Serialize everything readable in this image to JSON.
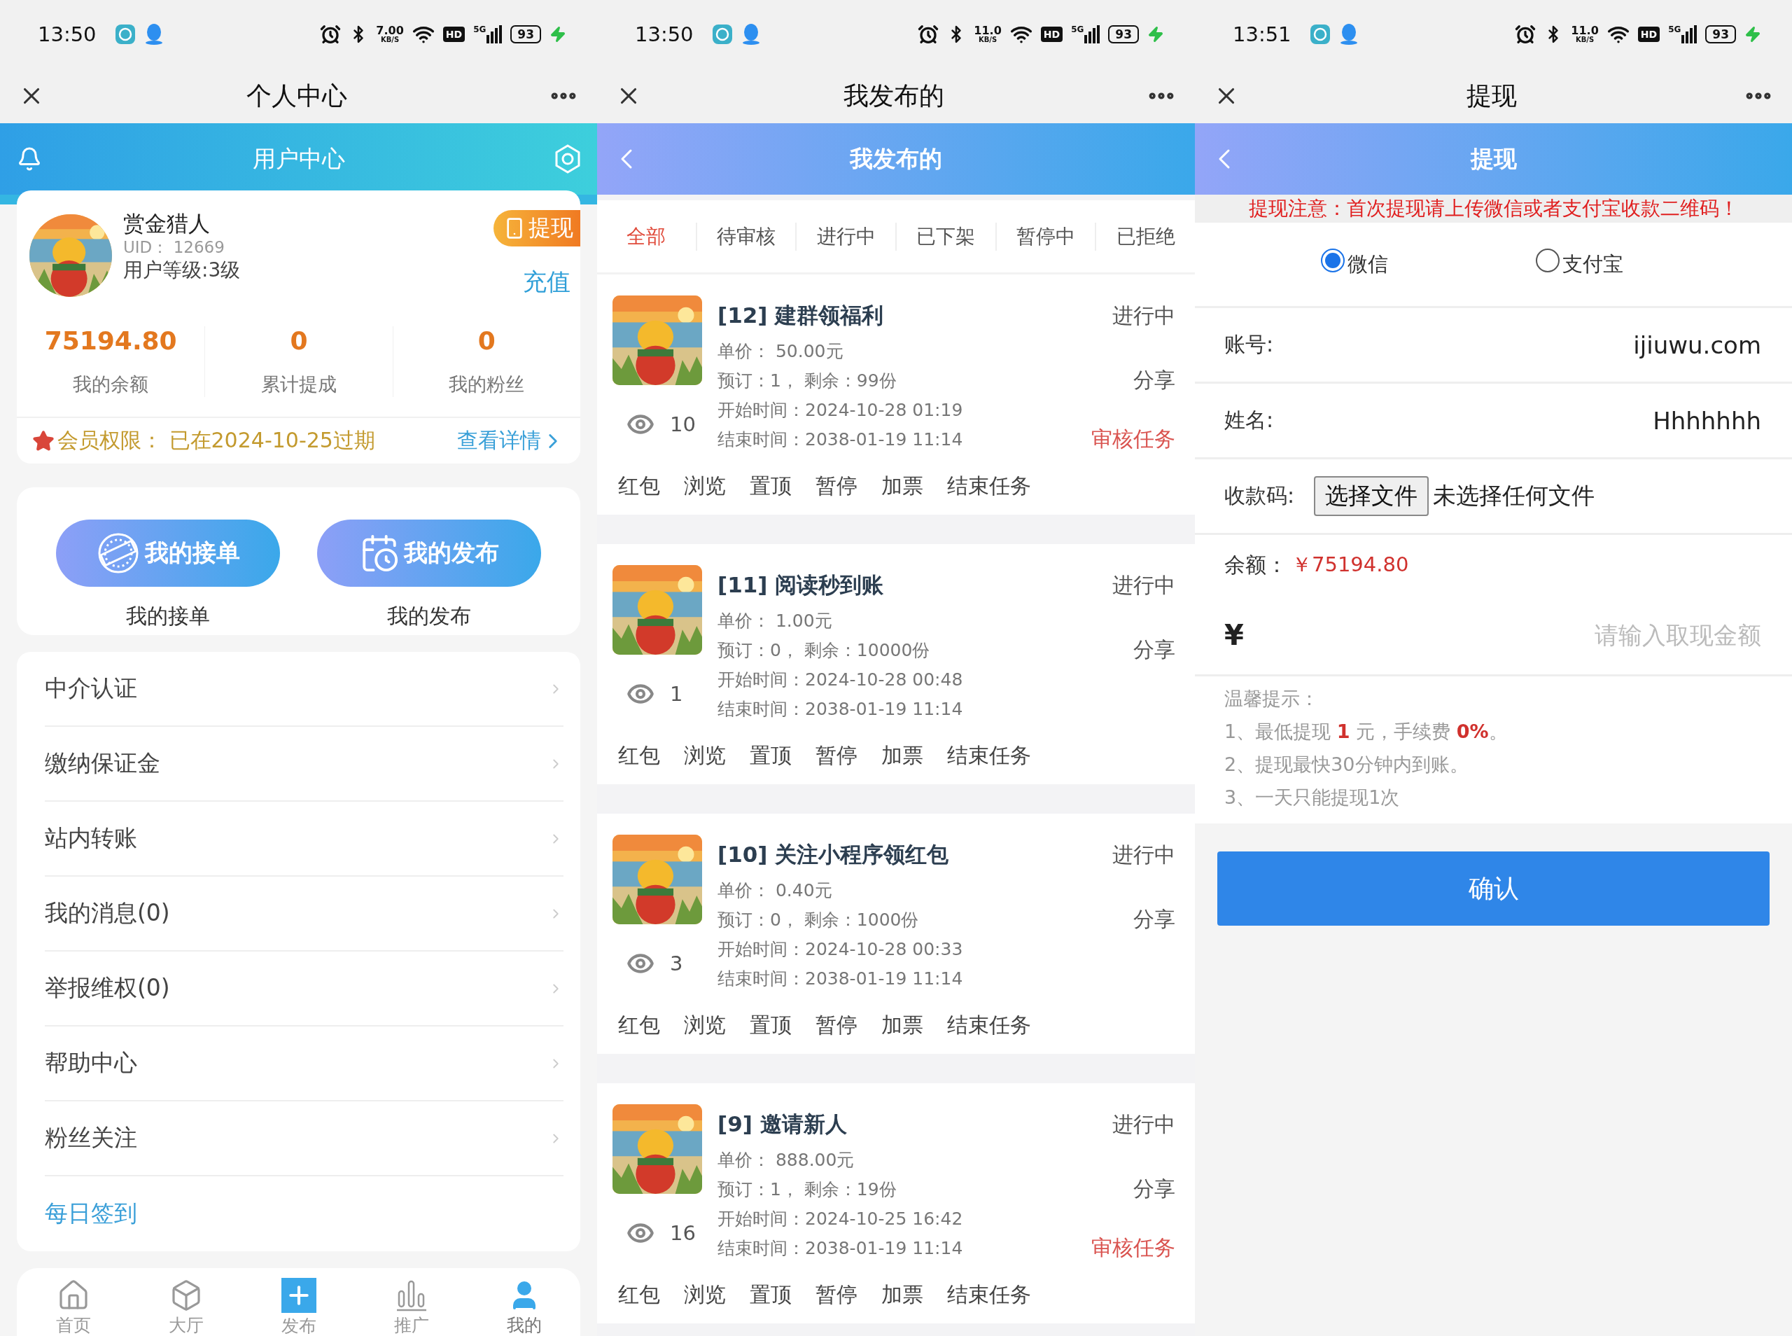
{
  "profile": {
    "status_bar": {
      "time": "13:50",
      "speed": "7.00",
      "speed_unit": "KB/S",
      "hd": "HD",
      "network": "5G",
      "battery": "93"
    },
    "top_bar": {
      "title": "个人中心"
    },
    "header": {
      "title": "用户中心"
    },
    "user": {
      "name": "赏金猎人",
      "uid": "UID：  12669",
      "level": "用户等级:3级",
      "withdraw_button": "提现",
      "recharge_link": "充值"
    },
    "stats": [
      {
        "value": "75194.80",
        "label": "我的余额"
      },
      {
        "value": "0",
        "label": "累计提成"
      },
      {
        "value": "0",
        "label": "我的粉丝"
      }
    ],
    "membership": {
      "text": "会员权限：  已在2024-10-25过期",
      "link": "查看详情"
    },
    "shortcuts": [
      {
        "button": "我的接单",
        "caption": "我的接单",
        "kind": "stamp"
      },
      {
        "button": "我的发布",
        "caption": "我的发布",
        "kind": "calendar"
      }
    ],
    "menu": [
      {
        "label": "中介认证",
        "kind": "link"
      },
      {
        "label": "缴纳保证金",
        "kind": "link"
      },
      {
        "label": "站内转账",
        "kind": "link"
      },
      {
        "label": "我的消息(0)",
        "kind": "link"
      },
      {
        "label": "举报维权(0)",
        "kind": "link"
      },
      {
        "label": "帮助中心",
        "kind": "link"
      },
      {
        "label": "粉丝关注",
        "kind": "link"
      },
      {
        "label": "每日签到",
        "kind": "accent"
      }
    ],
    "bottom_nav": [
      {
        "label": "首页",
        "kind": "home",
        "selected": false
      },
      {
        "label": "大厅",
        "kind": "box",
        "selected": false
      },
      {
        "label": "发布",
        "kind": "plus",
        "selected": false
      },
      {
        "label": "推广",
        "kind": "bars",
        "selected": false
      },
      {
        "label": "我的",
        "kind": "person",
        "selected": true
      }
    ]
  },
  "published": {
    "status_bar": {
      "time": "13:50",
      "speed": "11.0",
      "speed_unit": "KB/S",
      "hd": "HD",
      "network": "5G",
      "battery": "93"
    },
    "top_bar": {
      "title": "我发布的"
    },
    "header": {
      "title": "我发布的"
    },
    "tabs": [
      {
        "label": "全部",
        "selected": true
      },
      {
        "label": "待审核",
        "selected": false
      },
      {
        "label": "进行中",
        "selected": false
      },
      {
        "label": "已下架",
        "selected": false
      },
      {
        "label": "暂停中",
        "selected": false
      },
      {
        "label": "已拒绝",
        "selected": false
      }
    ],
    "tasks": [
      {
        "title": "[12] 建群领福利",
        "status": "进行中",
        "price": "单价：  50.00元",
        "booking": "预订：1，  剩余：99份",
        "share": "分享",
        "start": "开始时间：2024-10-28 01:19",
        "end": "结束时间：2038-01-19 11:14",
        "views": "10",
        "review": "审核任务",
        "actions": [
          "红包",
          "浏览",
          "置顶",
          "暂停",
          "加票",
          "结束任务"
        ]
      },
      {
        "title": "[11] 阅读秒到账",
        "status": "进行中",
        "price": "单价：  1.00元",
        "booking": "预订：0，  剩余：10000份",
        "share": "分享",
        "start": "开始时间：2024-10-28 00:48",
        "end": "结束时间：2038-01-19 11:14",
        "views": "1",
        "actions": [
          "红包",
          "浏览",
          "置顶",
          "暂停",
          "加票",
          "结束任务"
        ]
      },
      {
        "title": "[10] 关注小程序领红包",
        "status": "进行中",
        "price": "单价：  0.40元",
        "booking": "预订：0，  剩余：1000份",
        "share": "分享",
        "start": "开始时间：2024-10-28 00:33",
        "end": "结束时间：2038-01-19 11:14",
        "views": "3",
        "actions": [
          "红包",
          "浏览",
          "置顶",
          "暂停",
          "加票",
          "结束任务"
        ]
      },
      {
        "title": "[9] 邀请新人",
        "status": "进行中",
        "price": "单价：  888.00元",
        "booking": "预订：1，  剩余：19份",
        "share": "分享",
        "start": "开始时间：2024-10-25 16:42",
        "end": "结束时间：2038-01-19 11:14",
        "views": "16",
        "review": "审核任务",
        "actions": [
          "红包",
          "浏览",
          "置顶",
          "暂停",
          "加票",
          "结束任务"
        ]
      }
    ]
  },
  "withdraw": {
    "status_bar": {
      "time": "13:51",
      "speed": "11.0",
      "speed_unit": "KB/S",
      "hd": "HD",
      "network": "5G",
      "battery": "93"
    },
    "top_bar": {
      "title": "提现"
    },
    "header": {
      "title": "提现"
    },
    "notice": "提现注意：首次提现请上传微信或者支付宝收款二维码！",
    "methods": [
      {
        "label": "微信",
        "selected": true
      },
      {
        "label": "支付宝",
        "selected": false
      }
    ],
    "fields": [
      {
        "label": "账号:",
        "value": "ijiuwu.com",
        "kind": "text"
      },
      {
        "label": "姓名:",
        "value": "Hhhhhhh",
        "kind": "text"
      },
      {
        "label": "收款码:",
        "button": "选择文件",
        "value": "未选择任何文件",
        "kind": "file"
      }
    ],
    "balance": {
      "label": "余额：",
      "value": "￥75194.80"
    },
    "amount": {
      "symbol": "¥",
      "placeholder": "请输入取现金额"
    },
    "tips": {
      "title": "温馨提示：",
      "items": [
        "1、最低提现 **1** 元，手续费 **0%**。",
        "2、提现最快30分钟内到账。",
        "3、一天只能提现1次"
      ]
    },
    "confirm_button": "确认"
  }
}
